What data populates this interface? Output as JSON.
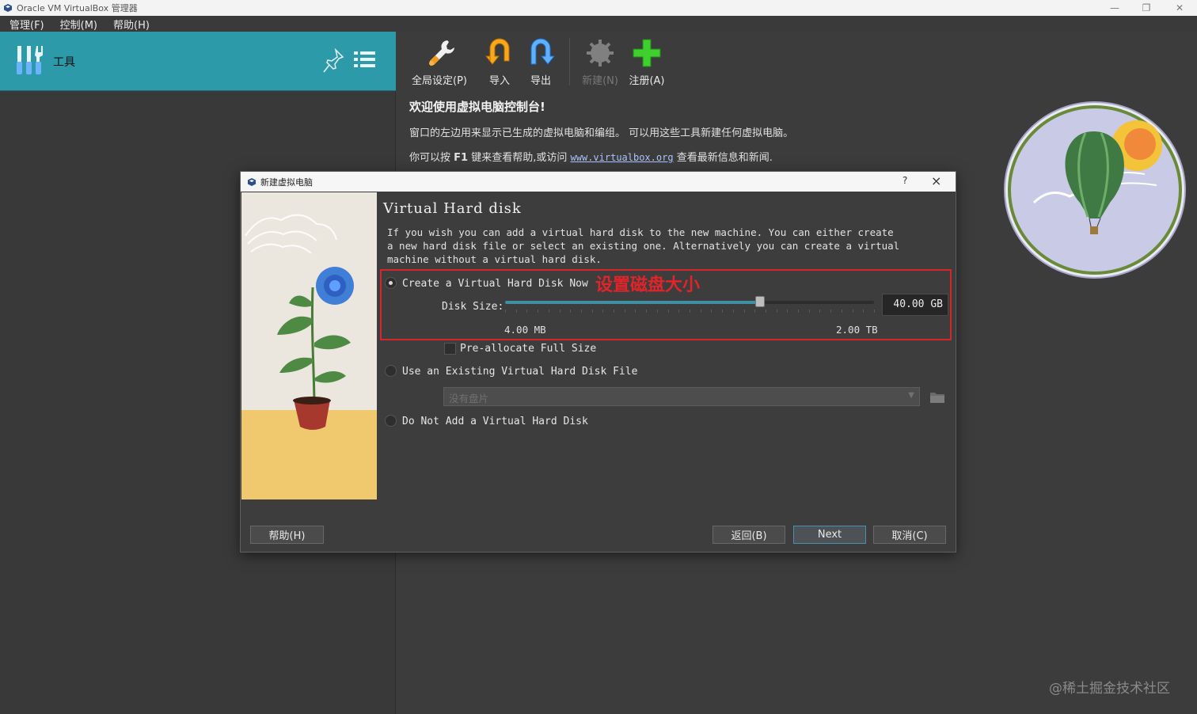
{
  "window": {
    "title": "Oracle VM VirtualBox 管理器"
  },
  "menu": [
    "管理(F)",
    "控制(M)",
    "帮助(H)"
  ],
  "sidebar": {
    "tools_label": "工具"
  },
  "toolbar": {
    "items": [
      {
        "label": "全局设定(P)",
        "icon": "wrench-icon",
        "enabled": true
      },
      {
        "label": "导入",
        "icon": "import-arrow-icon",
        "enabled": true
      },
      {
        "label": "导出",
        "icon": "export-arrow-icon",
        "enabled": true
      },
      {
        "label": "新建(N)",
        "icon": "gear-new-icon",
        "enabled": false
      },
      {
        "label": "注册(A)",
        "icon": "plus-icon",
        "enabled": true
      }
    ]
  },
  "welcome": {
    "title": "欢迎使用虚拟电脑控制台!",
    "line1": "窗口的左边用来显示已生成的虚拟电脑和编组。 可以用这些工具新建任何虚拟电脑。",
    "line2_prefix": "你可以按",
    "line2_key": "F1",
    "line2_mid": "键来查看帮助,或访问",
    "line2_link": "www.virtualbox.org",
    "line2_suffix": "查看最新信息和新闻."
  },
  "dialog": {
    "title": "新建虚拟电脑",
    "help_glyph": "?",
    "close_glyph": "×",
    "page_title": "Virtual Hard disk",
    "description": "If you wish you can add a virtual hard disk to the new machine. You can either create a new hard disk file or select an existing one. Alternatively you can create a virtual machine without a virtual hard disk.",
    "annotation": "设置磁盘大小",
    "options": {
      "create": "Create a Virtual Hard Disk Now",
      "existing": "Use an Existing Virtual Hard Disk File",
      "none": "Do Not Add a Virtual Hard Disk"
    },
    "selected_option": "create",
    "disk_size_label": "Disk Size:",
    "disk_size_value": "40.00 GB",
    "slider_fraction": 0.69,
    "slider_min": "4.00 MB",
    "slider_max": "2.00 TB",
    "preallocate_label": "Pre-allocate Full Size",
    "preallocate_checked": false,
    "existing_disk_placeholder": "没有盘片",
    "buttons": {
      "help": "帮助(H)",
      "back": "返回(B)",
      "next": "Next",
      "cancel": "取消(C)"
    }
  },
  "watermark": "@稀土掘金技术社区",
  "colors": {
    "accent": "#2c9aa9",
    "annotation_red": "#d6262b",
    "background": "#3c3c3c"
  }
}
